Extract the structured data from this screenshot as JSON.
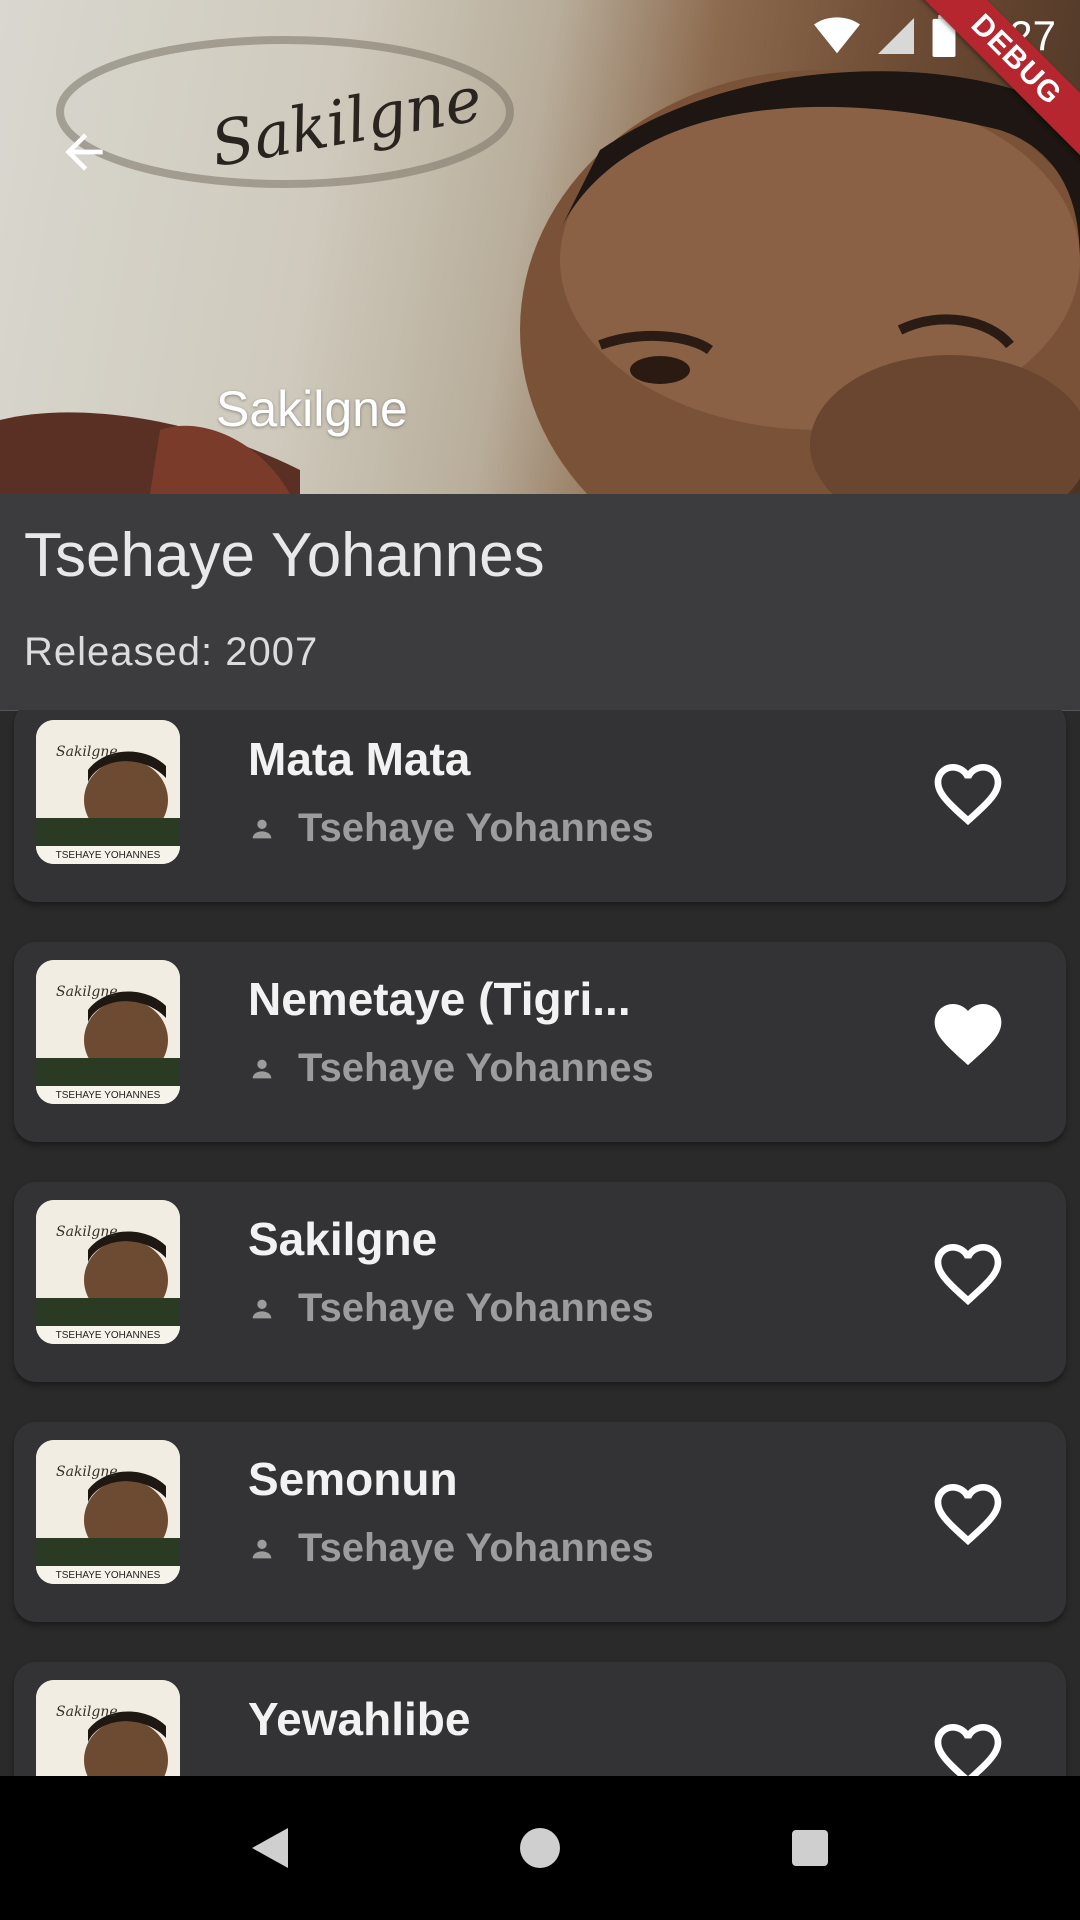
{
  "status_bar": {
    "time": "4:27",
    "debug_label": "DEBUG"
  },
  "header": {
    "album_title": "Sakilgne",
    "logo_text": "Sakilgne"
  },
  "album": {
    "artist": "Tsehaye Yohannes",
    "released": "Released: 2007"
  },
  "thumb_caption": "TSEHAYE YOHANNES",
  "songs": [
    {
      "title": "Mata Mata",
      "artist": "Tsehaye Yohannes",
      "favorite": false
    },
    {
      "title": "Nemetaye (Tigri...",
      "artist": "Tsehaye Yohannes",
      "favorite": true
    },
    {
      "title": "Sakilgne",
      "artist": "Tsehaye Yohannes",
      "favorite": false
    },
    {
      "title": "Semonun",
      "artist": "Tsehaye Yohannes",
      "favorite": false
    },
    {
      "title": "Yewahlibe",
      "artist": "",
      "favorite": false
    }
  ],
  "colors": {
    "background": "#2a2a2a",
    "card": "#333335",
    "info_panel": "#3c3c3e",
    "debug": "#b5262f"
  },
  "icons": {
    "back": "arrow-left-icon",
    "favorite_outline": "heart-outline-icon",
    "favorite_filled": "heart-filled-icon",
    "person": "person-icon",
    "nav_back": "triangle-back-icon",
    "nav_home": "circle-home-icon",
    "nav_recents": "square-recents-icon"
  }
}
